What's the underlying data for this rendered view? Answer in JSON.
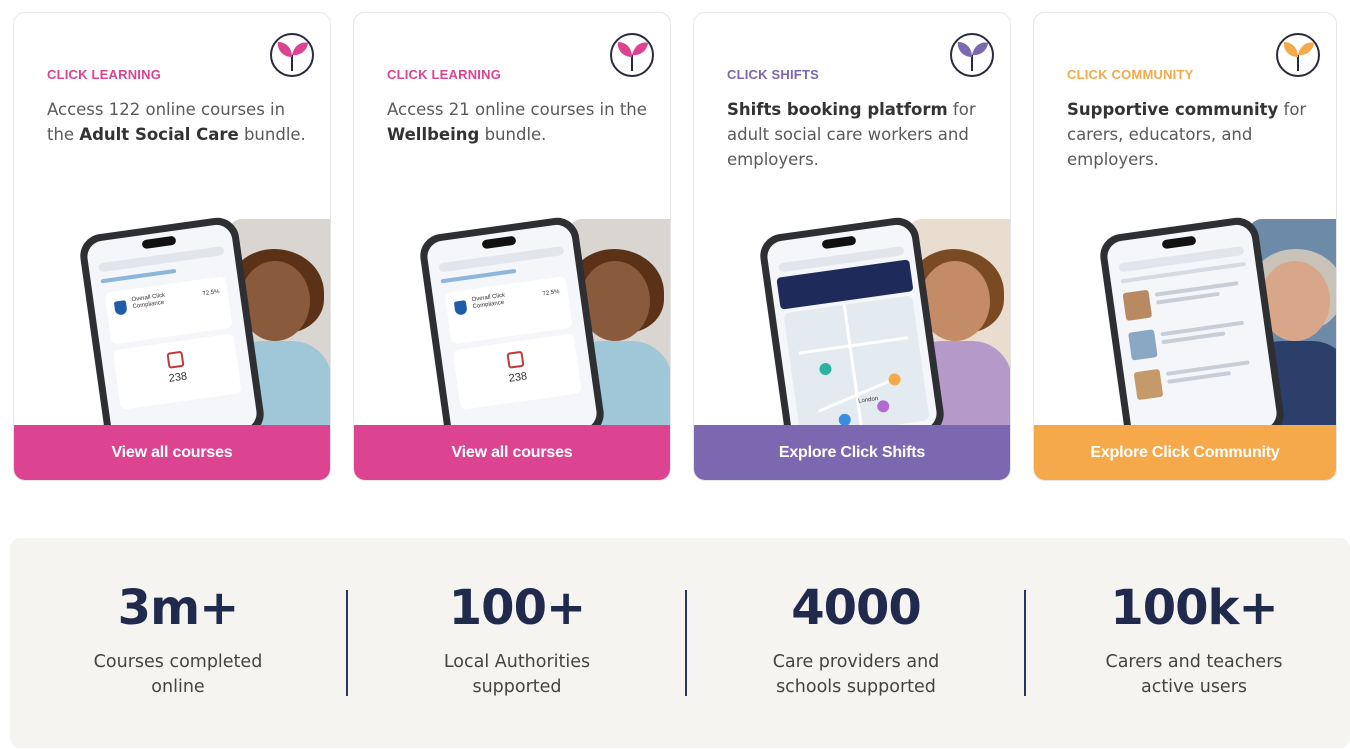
{
  "colors": {
    "learning": "#dc4492",
    "shifts": "#7b68b0",
    "community": "#f6a94a",
    "stats_bg": "#f5f4f1",
    "stats_num": "#1f2a4d"
  },
  "cards": [
    {
      "eyebrow": "CLICK LEARNING",
      "desc_a": "Access 122 online courses in the ",
      "desc_bold": "Adult Social Care",
      "desc_b": " bundle.",
      "cta": "View all courses",
      "icon": "sprout-logo-icon",
      "phone_stat_label": "Overall Click Compliance",
      "phone_stat_value": "72.5%",
      "phone_count": "238"
    },
    {
      "eyebrow": "CLICK LEARNING",
      "desc_a": "Access 21 online courses in the ",
      "desc_bold": "Wellbeing",
      "desc_b": " bundle.",
      "cta": "View all courses",
      "icon": "sprout-logo-icon",
      "phone_stat_label": "Overall Click Compliance",
      "phone_stat_value": "72.5%",
      "phone_count": "238"
    },
    {
      "eyebrow": "CLICK SHIFTS",
      "desc_bold": "Shifts booking platform",
      "desc_b": " for adult social care workers and employers.",
      "cta": "Explore Click Shifts",
      "icon": "sprout-logo-icon",
      "phone_map_label": "London"
    },
    {
      "eyebrow": "CLICK COMMUNITY",
      "desc_bold": "Supportive community",
      "desc_b": " for carers, educators, and employers.",
      "cta": "Explore Click Community",
      "icon": "sprout-logo-icon"
    }
  ],
  "stats": [
    {
      "value": "3m+",
      "label_1": "Courses completed",
      "label_2": "online"
    },
    {
      "value": "100+",
      "label_1": "Local Authorities",
      "label_2": "supported"
    },
    {
      "value": "4000",
      "label_1": "Care providers and",
      "label_2": "schools supported"
    },
    {
      "value": "100k+",
      "label_1": "Carers and teachers",
      "label_2": "active users"
    }
  ]
}
